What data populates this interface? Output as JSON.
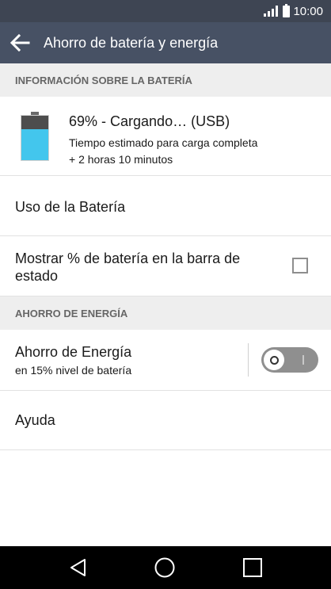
{
  "status_bar": {
    "time": "10:00"
  },
  "app_bar": {
    "title": "Ahorro de batería y energía"
  },
  "sections": {
    "battery_info_header": "INFORMACIÓN SOBRE LA BATERÍA",
    "energy_saving_header": "AHORRO DE ENERGÍA"
  },
  "battery": {
    "status": "69% - Cargando… (USB)",
    "estimate_line1": "Tiempo estimado para carga completa",
    "estimate_line2": "+ 2 horas 10 minutos",
    "level_percent": 69,
    "fill_color": "#43c6ed"
  },
  "items": {
    "battery_usage": "Uso de la Batería",
    "show_percent_line1": "Mostrar % de batería en la barra de",
    "show_percent_line2": "estado",
    "show_percent_checked": false,
    "energy_saver_title": "Ahorro de Energía",
    "energy_saver_sub": "en 15% nivel de batería",
    "energy_saver_on": false,
    "help": "Ayuda"
  },
  "colors": {
    "status_bar": "#3e4553",
    "app_bar": "#475164",
    "section_bg": "#eeeeee"
  }
}
